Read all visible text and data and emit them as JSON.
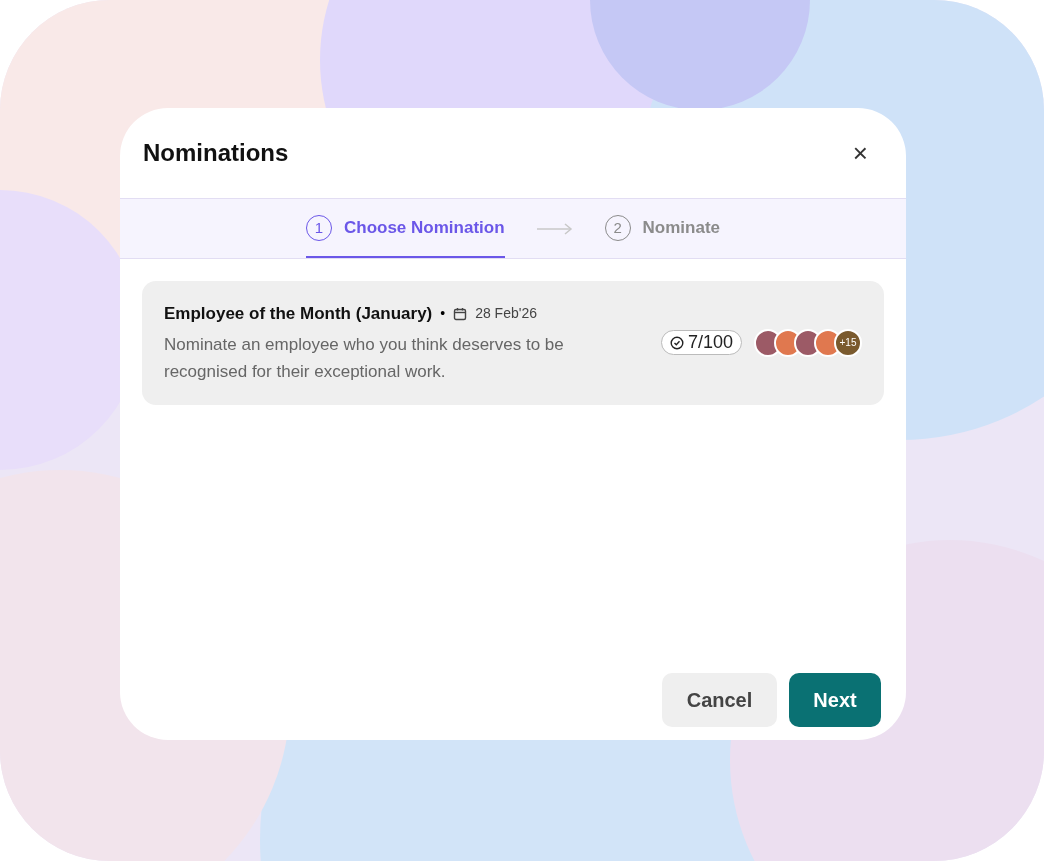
{
  "dialog": {
    "title": "Nominations",
    "close": "×"
  },
  "steps": [
    {
      "number": "1",
      "label": "Choose Nomination",
      "selected": true
    },
    {
      "number": "2",
      "label": "Nominate",
      "selected": false
    }
  ],
  "nominations": [
    {
      "title": "Employee of the Month (January)",
      "separator": "•",
      "date": "28 Feb'26",
      "description": "Nominate an employee who you think deserves to be recognised for their exceptional work.",
      "count": "7/100",
      "avatars": [
        {
          "kind": "photo"
        },
        {
          "kind": "photo"
        },
        {
          "kind": "photo"
        },
        {
          "kind": "photo"
        },
        {
          "kind": "more",
          "label": "+15"
        }
      ]
    }
  ],
  "buttons": [
    {
      "label": "Cancel",
      "kind": "secondary"
    },
    {
      "label": "Next",
      "kind": "primary"
    }
  ]
}
